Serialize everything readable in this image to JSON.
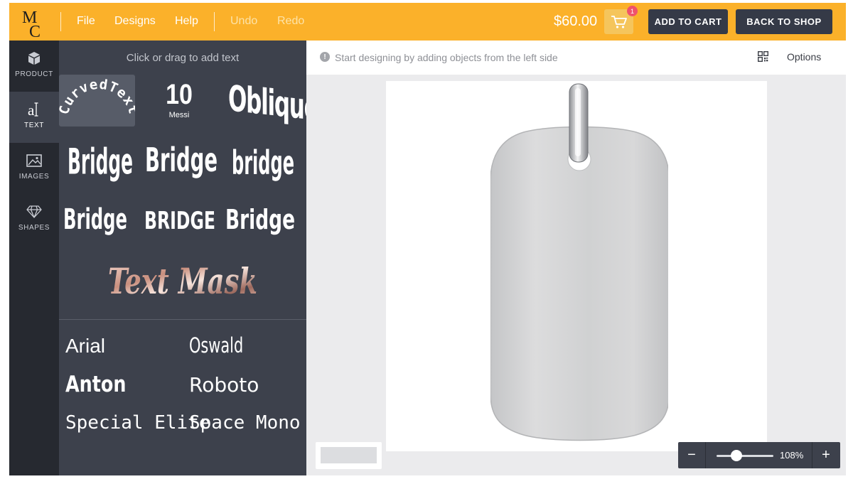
{
  "brand": {
    "logo_text": "MC",
    "accent": "#fbb12a"
  },
  "menu": {
    "file": "File",
    "designs": "Designs",
    "help": "Help",
    "undo": "Undo",
    "redo": "Redo"
  },
  "header": {
    "price": "$60.00",
    "cart_count": "1",
    "add_to_cart": "ADD TO CART",
    "back_to_shop": "BACK TO SHOP"
  },
  "sidebar": {
    "items": [
      {
        "label": "PRODUCT",
        "icon": "cube-icon",
        "active": false
      },
      {
        "label": "TEXT",
        "icon": "text-icon",
        "active": true
      },
      {
        "label": "IMAGES",
        "icon": "image-icon",
        "active": false
      },
      {
        "label": "SHAPES",
        "icon": "diamond-icon",
        "active": false
      }
    ]
  },
  "text_panel": {
    "hint": "Click or drag to add text",
    "presets": {
      "curved": "CurvedText",
      "jersey_number": "10",
      "jersey_name": "Messi",
      "oblique": "Oblique",
      "bridge": "Bridge",
      "bridge_upper": "BRIDGE",
      "bridge_lower": "bridge",
      "mask": "Text Mask"
    },
    "fonts": [
      "Arial",
      "Oswald",
      "Anton",
      "Roboto",
      "Special Elite",
      "Space Mono"
    ]
  },
  "canvas": {
    "info": "Start designing by adding objects from the left side",
    "options_label": "Options",
    "zoom_label": "108%",
    "zoom_level": 0.35
  }
}
